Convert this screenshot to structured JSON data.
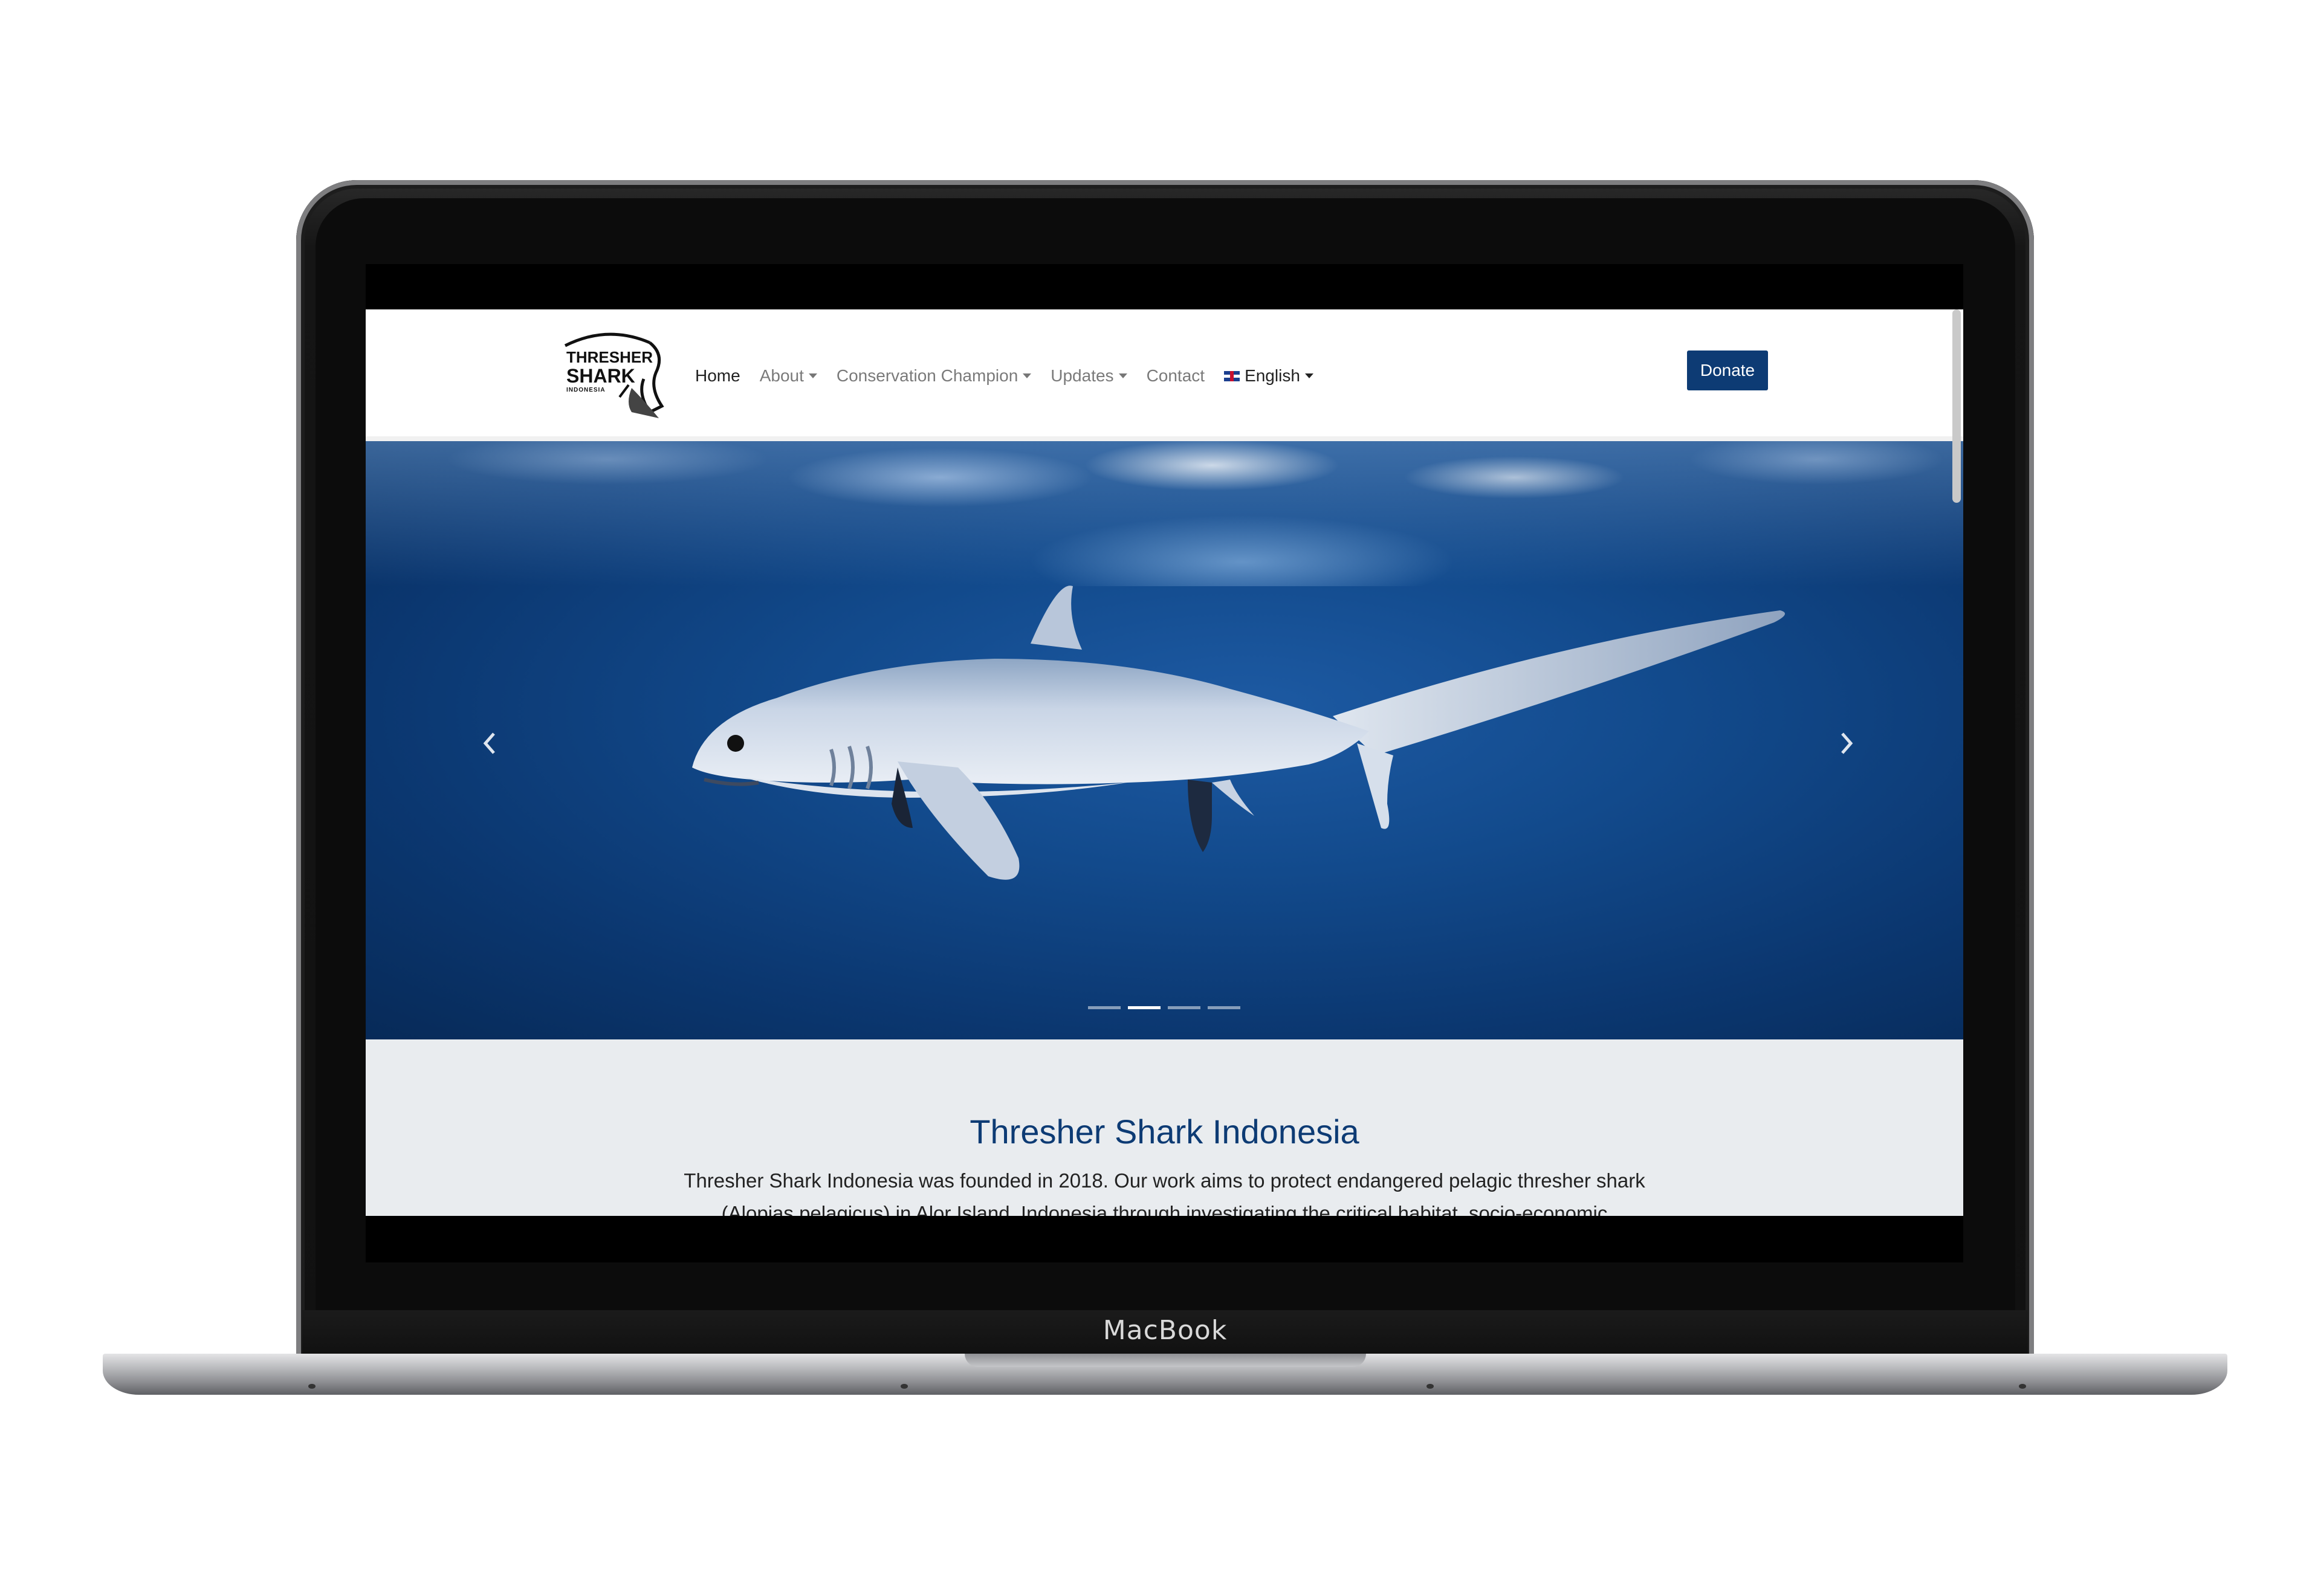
{
  "device": {
    "label": "MacBook"
  },
  "site": {
    "logo": {
      "line1": "THRESHER",
      "line2": "SHARK",
      "line3": "INDONESIA"
    },
    "nav": {
      "items": [
        {
          "label": "Home",
          "active": true,
          "dropdown": false
        },
        {
          "label": "About",
          "active": false,
          "dropdown": true
        },
        {
          "label": "Conservation Champion",
          "active": false,
          "dropdown": true
        },
        {
          "label": "Updates",
          "active": false,
          "dropdown": true
        },
        {
          "label": "Contact",
          "active": false,
          "dropdown": false
        }
      ],
      "language": {
        "label": "English",
        "icon": "uk-flag-icon"
      }
    },
    "donate_label": "Donate",
    "hero": {
      "prev_icon": "chevron-left-icon",
      "next_icon": "chevron-right-icon",
      "slides_count": 4,
      "active_slide": 2
    },
    "intro": {
      "title": "Thresher Shark Indonesia",
      "text": "Thresher Shark Indonesia was founded in 2018. Our work aims to protect endangered pelagic thresher shark (Alopias pelagicus) in Alor Island, Indonesia through investigating the critical habitat, socio-economic"
    }
  },
  "colors": {
    "brand_blue": "#0d3b74",
    "intro_background": "#e9ecef",
    "ocean": "#0b3770"
  }
}
